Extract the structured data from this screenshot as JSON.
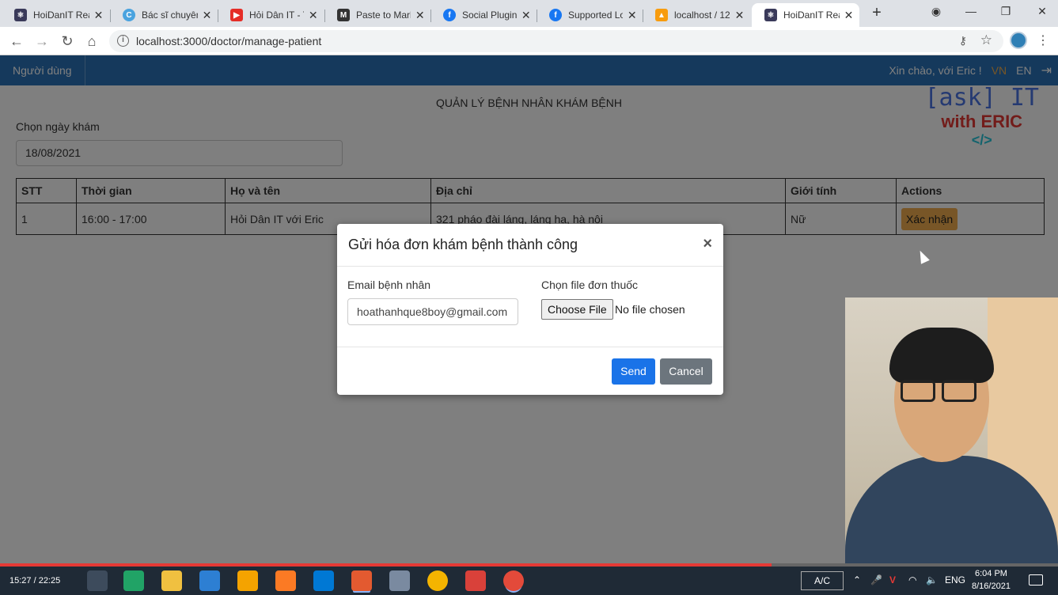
{
  "browser": {
    "tabs": [
      {
        "title": "HoiDanIT Rea",
        "icon": "react-icon",
        "color": "#3a3a5a",
        "active": false
      },
      {
        "title": "Bác sĩ chuyên",
        "icon": "bookingcare-icon",
        "color": "#4aa3df",
        "active": false
      },
      {
        "title": "Hỏi Dân IT - Y",
        "icon": "youtube-icon",
        "color": "#e52d27",
        "active": false
      },
      {
        "title": "Paste to Mark",
        "icon": "markdown-icon",
        "color": "#333333",
        "active": false
      },
      {
        "title": "Social Plugins",
        "icon": "facebook-icon",
        "color": "#1877f2",
        "active": false
      },
      {
        "title": "Supported Lo",
        "icon": "facebook-icon",
        "color": "#1877f2",
        "active": false
      },
      {
        "title": "localhost / 12",
        "icon": "phpmyadmin-icon",
        "color": "#f89c0e",
        "active": false
      },
      {
        "title": "HoiDanIT Rea",
        "icon": "react-icon",
        "color": "#3a3a5a",
        "active": true
      }
    ],
    "url": "localhost:3000/doctor/manage-patient"
  },
  "navbar": {
    "menu_item": "Người dùng",
    "welcome": "Xin chào, với Eric !",
    "lang_vn": "VN",
    "lang_en": "EN",
    "active_lang": "VN"
  },
  "page": {
    "title": "QUẢN LÝ BỆNH NHÂN KHÁM BỆNH",
    "date_label": "Chọn ngày khám",
    "date_value": "18/08/2021"
  },
  "watermark": {
    "line1": "[ask] IT",
    "line2": "with ERIC",
    "line3": "</>"
  },
  "table": {
    "headers": [
      "STT",
      "Thời gian",
      "Họ và tên",
      "Địa chỉ",
      "Giới tính",
      "Actions"
    ],
    "rows": [
      {
        "stt": "1",
        "time": "16:00 - 17:00",
        "name": "Hỏi Dân IT với Eric",
        "address": "321 pháo đài láng, láng hạ, hà nội",
        "gender": "Nữ",
        "action": "Xác nhận"
      }
    ]
  },
  "modal": {
    "title": "Gửi hóa đơn khám bệnh thành công",
    "close": "×",
    "email_label": "Email bệnh nhân",
    "email_value": "hoathanhque8boy@gmail.com",
    "file_label": "Chọn file đơn thuốc",
    "choose_file": "Choose File",
    "no_file": "No file chosen",
    "send": "Send",
    "cancel": "Cancel"
  },
  "video": {
    "time": "15:27 / 22:25",
    "progress": 0.7294
  },
  "taskbar": {
    "ac": "A/C",
    "lang": "ENG",
    "time": "6:04 PM",
    "date": "8/16/2021"
  }
}
